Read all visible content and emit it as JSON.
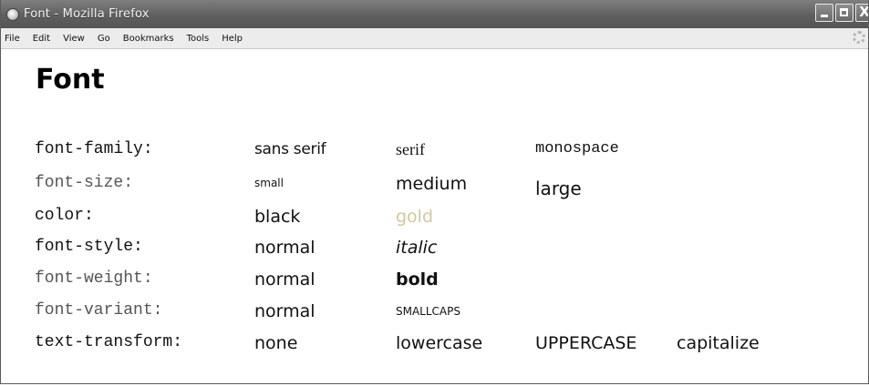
{
  "window": {
    "title": "Font - Mozilla Firefox",
    "icon": "firefox-icon",
    "controls": [
      "minimize-icon",
      "maximize-icon",
      "close-icon"
    ],
    "close_glyph": "X"
  },
  "menubar": {
    "items": [
      "File",
      "Edit",
      "View",
      "Go",
      "Bookmarks",
      "Tools",
      "Help"
    ],
    "status_icon": "throbber-icon"
  },
  "page": {
    "title": "Font",
    "gold_color": "#d2c8a0",
    "rows": [
      {
        "property": "font-family:",
        "values": [
          "sans serif",
          "serif",
          "monospace"
        ]
      },
      {
        "property": "font-size:",
        "values": [
          "small",
          "medium",
          "large"
        ]
      },
      {
        "property": "color:",
        "values": [
          "black",
          "gold"
        ]
      },
      {
        "property": "font-style:",
        "values": [
          "normal",
          "italic"
        ]
      },
      {
        "property": "font-weight:",
        "values": [
          "normal",
          "bold"
        ]
      },
      {
        "property": "font-variant:",
        "values": [
          "normal",
          "smallcaps"
        ]
      },
      {
        "property": "text-transform:",
        "values": [
          "none",
          "lowercase",
          "uppercase",
          "capitalize"
        ]
      }
    ]
  }
}
